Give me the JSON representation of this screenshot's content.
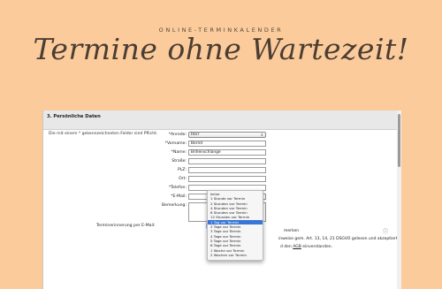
{
  "hero": {
    "eyebrow": "ONLINE-TERMINKALENDER",
    "headline": "Termine ohne Wartezeit!"
  },
  "form": {
    "section_title": "3. Persönliche Daten",
    "note": "Die mit einem * gekennzeichneten Felder sind Pflicht.",
    "fields": {
      "anrede": {
        "label": "*Anrede:",
        "value": "Herr"
      },
      "vorname": {
        "label": "*Vorname:",
        "value": "Bernd"
      },
      "name": {
        "label": "*Name:",
        "value": "Brillenschlange"
      },
      "strasse": {
        "label": "Straße:",
        "value": ""
      },
      "plz": {
        "label": "PLZ:",
        "value": ""
      },
      "ort": {
        "label": "Ort:",
        "value": ""
      },
      "telefon": {
        "label": "*Telefon:",
        "value": ""
      },
      "email": {
        "label": "*E-Mail:",
        "value": ""
      },
      "bemerkung": {
        "label": "Bemerkung:",
        "value": ""
      }
    },
    "reminder": {
      "label": "Terminerinnerung per E-Mail:",
      "options": [
        "keine",
        "1 Stunde vor Termin",
        "2 Stunden vor Termin",
        "4 Stunden vor Termin",
        "8 Stunden vor Termin",
        "12 Stunden vor Termin",
        "1 Tag vor Termin",
        "2 Tage vor Termin",
        "3 Tage vor Termin",
        "4 Tage vor Termin",
        "5 Tage vor Termin",
        "6 Tage vor Termin",
        "1 Woche vor Termin",
        "2 Wochen vor Termin"
      ],
      "selected_index": 6
    },
    "tail_lines": {
      "line1": "merken",
      "line2": "inweise gem. Art. 13, 14, 21 DSGVO gelesen und akzeptiert.*",
      "line3_prefix": "d den ",
      "line3_link": "AGB",
      "line3_suffix": " einverstanden."
    },
    "info_icon": "info-icon"
  }
}
